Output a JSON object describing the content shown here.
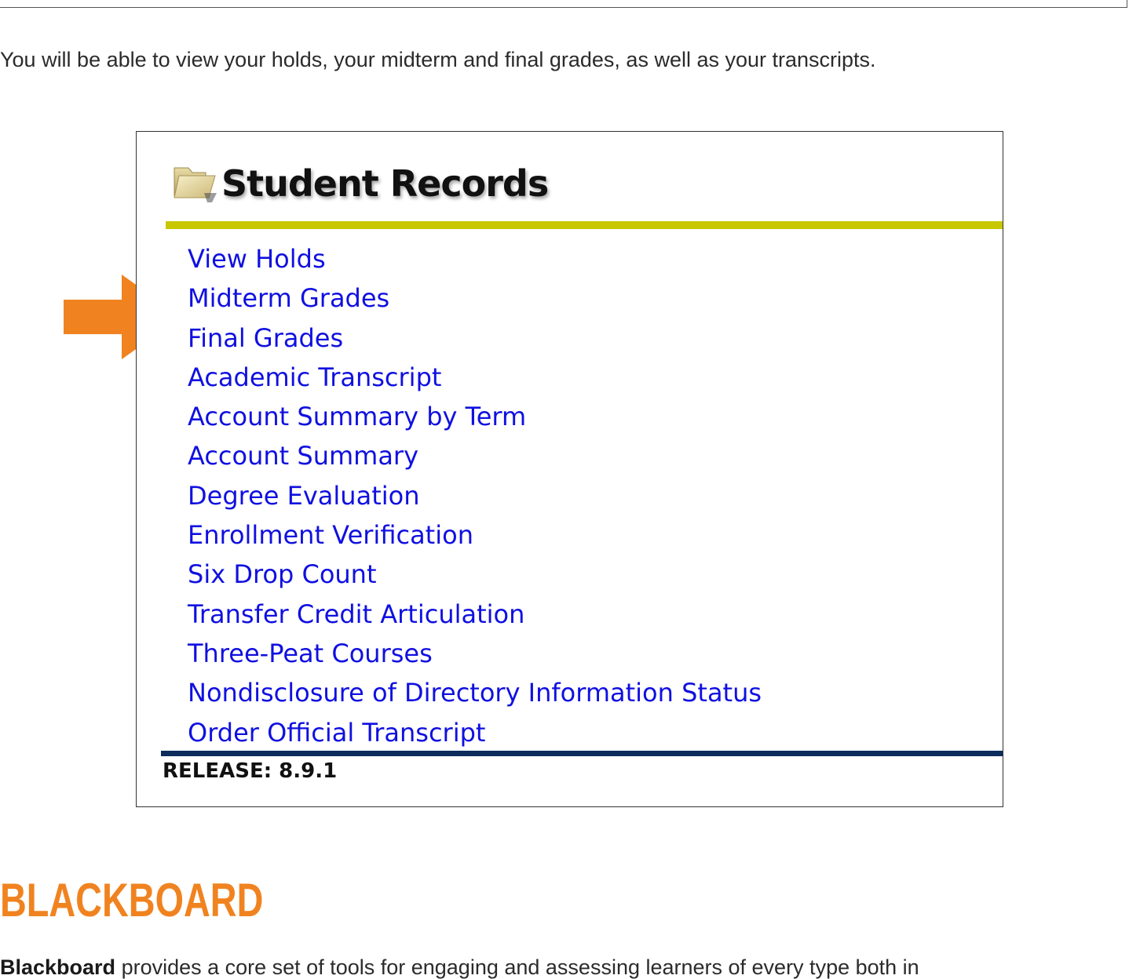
{
  "intro_text": "You will be able to view your holds, your midterm and final grades, as well as your transcripts.",
  "panel": {
    "title": "Student Records",
    "icon": "folder-icon",
    "links": [
      "View Holds",
      "Midterm Grades",
      "Final Grades",
      "Academic Transcript",
      "Account Summary by Term",
      "Account Summary",
      "Degree Evaluation",
      "Enrollment Verification",
      "Six Drop Count",
      "Transfer Credit Articulation",
      "Three-Peat Courses",
      "Nondisclosure of Directory Information Status",
      "Order Official Transcript"
    ],
    "release": "RELEASE: 8.9.1"
  },
  "colors": {
    "link": "#1010e0",
    "olive_rule": "#c8c800",
    "navy_rule": "#0c2c5c",
    "accent_orange": "#f08320"
  },
  "section": {
    "heading": "BLACKBOARD",
    "body_bold": "Blackboard",
    "body_rest": " provides a core set of tools for engaging and assessing learners of every type both in"
  }
}
